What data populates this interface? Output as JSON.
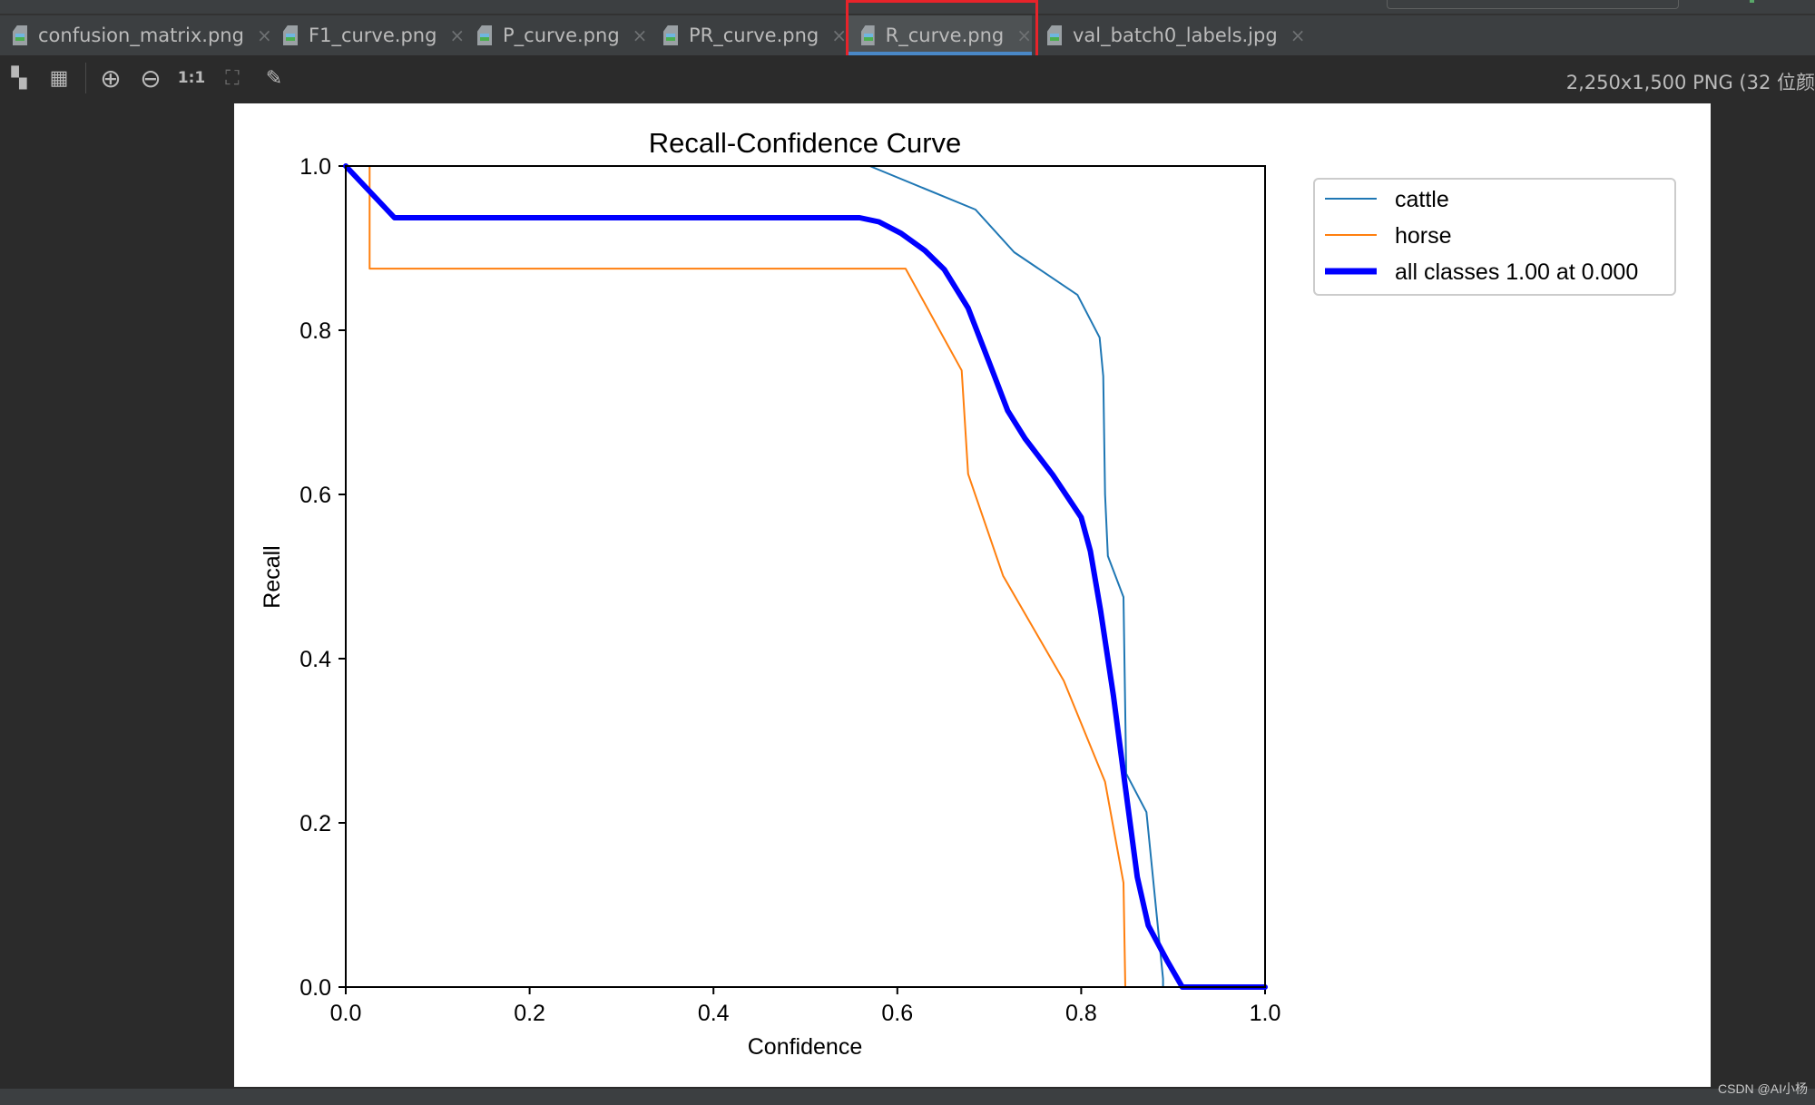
{
  "tabs": [
    {
      "label": "confusion_matrix.png",
      "active": false
    },
    {
      "label": "F1_curve.png",
      "active": false
    },
    {
      "label": "P_curve.png",
      "active": false
    },
    {
      "label": "PR_curve.png",
      "active": false
    },
    {
      "label": "R_curve.png",
      "active": true
    },
    {
      "label": "val_batch0_labels.jpg",
      "active": false
    }
  ],
  "toolbar": {
    "buttons": [
      {
        "name": "chessboard-background-icon",
        "glyph": "▚"
      },
      {
        "name": "grid-icon",
        "glyph": "▦"
      },
      {
        "name": "zoom-in-icon",
        "glyph": "⊕"
      },
      {
        "name": "zoom-out-icon",
        "glyph": "⊖"
      },
      {
        "name": "actual-size-icon",
        "glyph": "1:1"
      },
      {
        "name": "fit-to-window-icon",
        "glyph": "⛶"
      },
      {
        "name": "color-picker-icon",
        "glyph": "✎"
      }
    ],
    "image_info": "2,250x1,500 PNG (32 位颜"
  },
  "watermark": "CSDN @AI小杨",
  "highlight_color": "#e8232a",
  "chart_data": {
    "type": "line",
    "title": "Recall-Confidence Curve",
    "xlabel": "Confidence",
    "ylabel": "Recall",
    "xlim": [
      0,
      1
    ],
    "ylim": [
      0,
      1
    ],
    "xticks": [
      "0.0",
      "0.2",
      "0.4",
      "0.6",
      "0.8",
      "1.0"
    ],
    "yticks": [
      "0.0",
      "0.2",
      "0.4",
      "0.6",
      "0.8",
      "1.0"
    ],
    "grid": false,
    "legend_position": "outside-top-right",
    "series": [
      {
        "name": "cattle",
        "color": "#1f77b4",
        "x": [
          0.0,
          0.57,
          0.685,
          0.727,
          0.796,
          0.82,
          0.824,
          0.826,
          0.829,
          0.846,
          0.849,
          0.871,
          0.889,
          0.889,
          1.0
        ],
        "y": [
          1.0,
          1.0,
          0.947,
          0.895,
          0.843,
          0.791,
          0.744,
          0.6,
          0.525,
          0.475,
          0.26,
          0.213,
          0.01,
          0.0,
          0.0
        ]
      },
      {
        "name": "horse",
        "color": "#ff7f0e",
        "x": [
          0.0,
          0.026,
          0.026,
          0.609,
          0.67,
          0.677,
          0.715,
          0.781,
          0.826,
          0.846,
          0.848,
          0.848,
          1.0
        ],
        "y": [
          1.0,
          1.0,
          0.875,
          0.875,
          0.751,
          0.625,
          0.501,
          0.373,
          0.25,
          0.127,
          0.0,
          0.0,
          0.0
        ]
      },
      {
        "name": "all classes 1.00 at 0.000",
        "color": "#0000ff",
        "x": [
          0.0,
          0.053,
          0.559,
          0.58,
          0.604,
          0.63,
          0.651,
          0.677,
          0.703,
          0.72,
          0.739,
          0.769,
          0.8,
          0.81,
          0.821,
          0.831,
          0.835,
          0.848,
          0.861,
          0.873,
          0.894,
          0.91,
          1.0
        ],
        "y": [
          1.0,
          0.937,
          0.937,
          0.932,
          0.918,
          0.897,
          0.874,
          0.827,
          0.752,
          0.702,
          0.668,
          0.624,
          0.572,
          0.531,
          0.459,
          0.385,
          0.355,
          0.244,
          0.134,
          0.075,
          0.031,
          0.0,
          0.0
        ]
      }
    ]
  }
}
